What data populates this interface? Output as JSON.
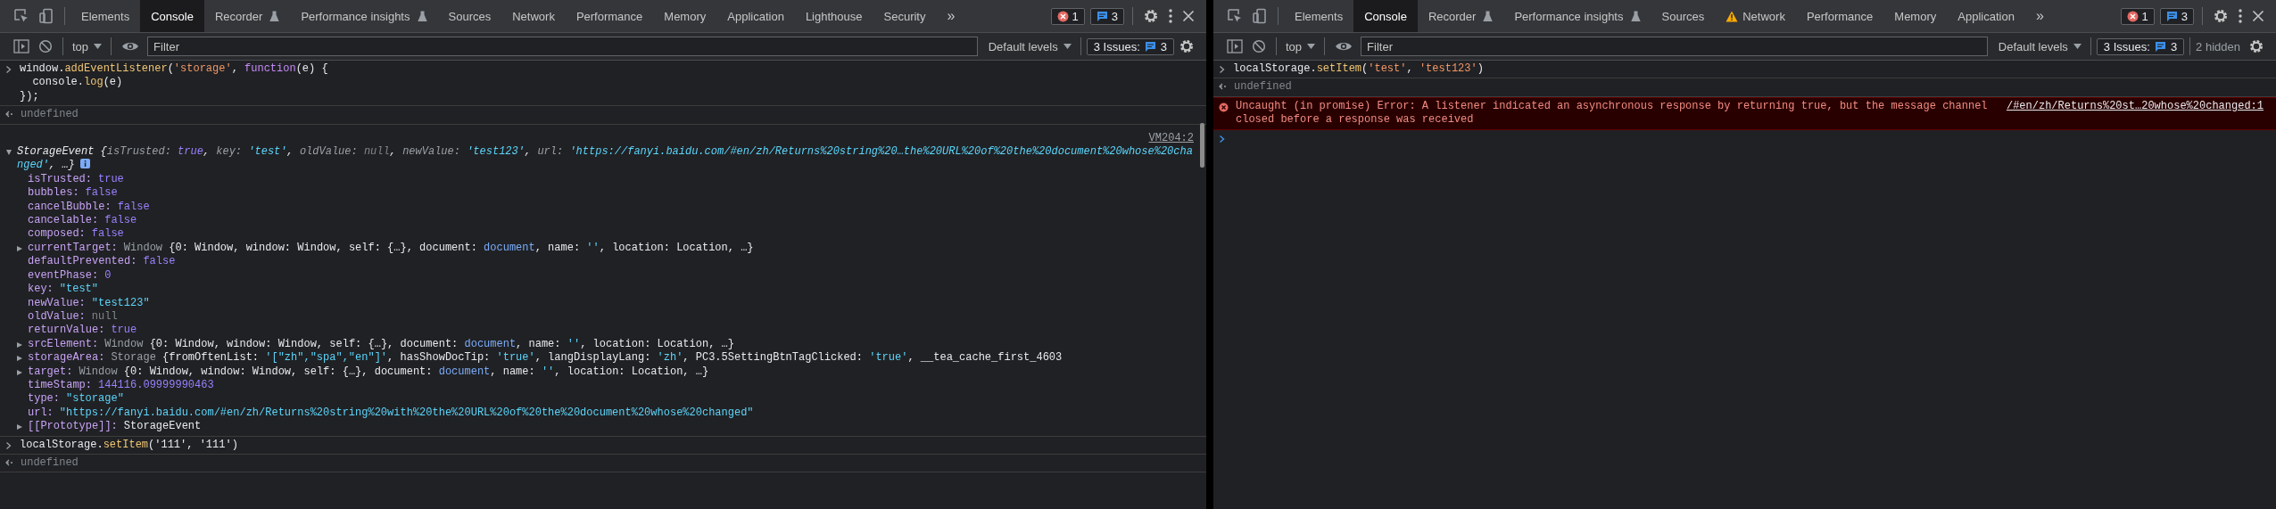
{
  "panels": [
    {
      "tabs": [
        {
          "label": "Elements",
          "selected": false,
          "kind": "standard"
        },
        {
          "label": "Console",
          "selected": true,
          "kind": "standard"
        },
        {
          "label": "Recorder",
          "selected": false,
          "kind": "experimental"
        },
        {
          "label": "Performance insights",
          "selected": false,
          "kind": "experimental"
        },
        {
          "label": "Sources",
          "selected": false,
          "kind": "standard"
        },
        {
          "label": "Network",
          "selected": false,
          "kind": "standard"
        },
        {
          "label": "Performance",
          "selected": false,
          "kind": "standard"
        },
        {
          "label": "Memory",
          "selected": false,
          "kind": "standard"
        },
        {
          "label": "Application",
          "selected": false,
          "kind": "standard"
        },
        {
          "label": "Lighthouse",
          "selected": false,
          "kind": "standard"
        },
        {
          "label": "Security",
          "selected": false,
          "kind": "standard"
        }
      ],
      "overflow": "»",
      "counts": {
        "errors": "1",
        "messages": "3"
      },
      "toolbar": {
        "context": "top",
        "filter": {
          "placeholder": "Filter"
        },
        "levels": "Default levels",
        "issues_label": "3 Issues:",
        "issues_count": "3"
      },
      "console": [
        {
          "kind": "input",
          "lines": [
            [
              {
                "t": "window.",
                "kind": "text"
              },
              {
                "t": "addEventListener",
                "kind": "method"
              },
              {
                "t": "(",
                "kind": "text"
              },
              {
                "t": "'storage'",
                "kind": "literal"
              },
              {
                "t": ", ",
                "kind": "text"
              },
              {
                "t": "function",
                "kind": "keyword"
              },
              {
                "t": "(e) {",
                "kind": "text"
              }
            ],
            [
              {
                "t": "  console.",
                "kind": "text"
              },
              {
                "t": "log",
                "kind": "method"
              },
              {
                "t": "(e)",
                "kind": "text"
              }
            ],
            [
              {
                "t": "});",
                "kind": "text"
              }
            ]
          ]
        },
        {
          "kind": "result",
          "text": "undefined"
        },
        {
          "kind": "object",
          "source": "VM204:2",
          "expanded": true,
          "summary": [
            {
              "t": "StorageEvent {",
              "kind": "text"
            },
            {
              "t": "isTrusted: ",
              "kind": "dim"
            },
            {
              "t": "true",
              "kind": "bool"
            },
            {
              "t": ", ",
              "kind": "text"
            },
            {
              "t": "key: ",
              "kind": "dim"
            },
            {
              "t": "'test'",
              "kind": "string"
            },
            {
              "t": ", ",
              "kind": "text"
            },
            {
              "t": "oldValue: ",
              "kind": "dim"
            },
            {
              "t": "null",
              "kind": "null"
            },
            {
              "t": ", ",
              "kind": "text"
            },
            {
              "t": "newValue: ",
              "kind": "dim"
            },
            {
              "t": "'test123'",
              "kind": "string"
            },
            {
              "t": ", ",
              "kind": "text"
            },
            {
              "t": "url: ",
              "kind": "dim"
            },
            {
              "t": "'https://fanyi.baidu.com/#en/zh/Returns%20string%20…the%20URL%20of%20the%20document%20whose%20changed'",
              "kind": "string"
            },
            {
              "t": ", …}",
              "kind": "text"
            }
          ],
          "props": [
            {
              "name": "isTrusted:",
              "kind": "leaf",
              "value": [
                {
                  "t": "true",
                  "kind": "bool"
                }
              ]
            },
            {
              "name": "bubbles:",
              "kind": "leaf",
              "value": [
                {
                  "t": "false",
                  "kind": "bool"
                }
              ]
            },
            {
              "name": "cancelBubble:",
              "kind": "leaf",
              "value": [
                {
                  "t": "false",
                  "kind": "bool"
                }
              ]
            },
            {
              "name": "cancelable:",
              "kind": "leaf",
              "value": [
                {
                  "t": "false",
                  "kind": "bool"
                }
              ]
            },
            {
              "name": "composed:",
              "kind": "leaf",
              "value": [
                {
                  "t": "false",
                  "kind": "bool"
                }
              ]
            },
            {
              "name": "currentTarget:",
              "kind": "object",
              "expanded": false,
              "value": [
                {
                  "t": "Window ",
                  "kind": "dim"
                },
                {
                  "t": "{0: Window, window: Window, self: {…}, document: ",
                  "kind": "text"
                },
                {
                  "t": "document",
                  "kind": "node"
                },
                {
                  "t": ", name: ",
                  "kind": "text"
                },
                {
                  "t": "''",
                  "kind": "string"
                },
                {
                  "t": ", location: Location, …}",
                  "kind": "text"
                }
              ]
            },
            {
              "name": "defaultPrevented:",
              "kind": "leaf",
              "value": [
                {
                  "t": "false",
                  "kind": "bool"
                }
              ]
            },
            {
              "name": "eventPhase:",
              "kind": "leaf",
              "value": [
                {
                  "t": "0",
                  "kind": "bool"
                }
              ]
            },
            {
              "name": "key:",
              "kind": "leaf",
              "value": [
                {
                  "t": "\"test\"",
                  "kind": "string"
                }
              ]
            },
            {
              "name": "newValue:",
              "kind": "leaf",
              "value": [
                {
                  "t": "\"test123\"",
                  "kind": "string"
                }
              ]
            },
            {
              "name": "oldValue:",
              "kind": "leaf",
              "value": [
                {
                  "t": "null",
                  "kind": "null"
                }
              ]
            },
            {
              "name": "returnValue:",
              "kind": "leaf",
              "value": [
                {
                  "t": "true",
                  "kind": "bool"
                }
              ]
            },
            {
              "name": "srcElement:",
              "kind": "object",
              "expanded": false,
              "value": [
                {
                  "t": "Window ",
                  "kind": "dim"
                },
                {
                  "t": "{0: Window, window: Window, self: {…}, document: ",
                  "kind": "text"
                },
                {
                  "t": "document",
                  "kind": "node"
                },
                {
                  "t": ", name: ",
                  "kind": "text"
                },
                {
                  "t": "''",
                  "kind": "string"
                },
                {
                  "t": ", location: Location, …}",
                  "kind": "text"
                }
              ]
            },
            {
              "name": "storageArea:",
              "kind": "object",
              "expanded": false,
              "value": [
                {
                  "t": "Storage ",
                  "kind": "dim"
                },
                {
                  "t": "{fromOftenList: ",
                  "kind": "text"
                },
                {
                  "t": "'[\"zh\",\"spa\",\"en\"]'",
                  "kind": "string"
                },
                {
                  "t": ", hasShowDocTip: ",
                  "kind": "text"
                },
                {
                  "t": "'true'",
                  "kind": "string"
                },
                {
                  "t": ", langDisplayLang: ",
                  "kind": "text"
                },
                {
                  "t": "'zh'",
                  "kind": "string"
                },
                {
                  "t": ", PC3.5SettingBtnTagClicked: ",
                  "kind": "text"
                },
                {
                  "t": "'true'",
                  "kind": "string"
                },
                {
                  "t": ", __tea_cache_first_4603",
                  "kind": "text"
                }
              ]
            },
            {
              "name": "target:",
              "kind": "object",
              "expanded": false,
              "value": [
                {
                  "t": "Window ",
                  "kind": "dim"
                },
                {
                  "t": "{0: Window, window: Window, self: {…}, document: ",
                  "kind": "text"
                },
                {
                  "t": "document",
                  "kind": "node"
                },
                {
                  "t": ", name: ",
                  "kind": "text"
                },
                {
                  "t": "''",
                  "kind": "string"
                },
                {
                  "t": ", location: Location, …}",
                  "kind": "text"
                }
              ]
            },
            {
              "name": "timeStamp:",
              "kind": "leaf",
              "value": [
                {
                  "t": "144116.09999990463",
                  "kind": "bool"
                }
              ]
            },
            {
              "name": "type:",
              "kind": "leaf",
              "value": [
                {
                  "t": "\"storage\"",
                  "kind": "string"
                }
              ]
            },
            {
              "name": "url:",
              "kind": "leaf",
              "value": [
                {
                  "t": "\"https://fanyi.baidu.com/#en/zh/Returns%20string%20with%20the%20URL%20of%20the%20document%20whose%20changed\"",
                  "kind": "string"
                }
              ]
            },
            {
              "name": "[[Prototype]]:",
              "kind": "object",
              "expanded": false,
              "value": [
                {
                  "t": "StorageEvent",
                  "kind": "text"
                }
              ]
            }
          ]
        },
        {
          "kind": "input",
          "lines": [
            [
              {
                "t": "localStorage.",
                "kind": "text"
              },
              {
                "t": "setItem",
                "kind": "method"
              },
              {
                "t": "('111', '111')",
                "kind": "text"
              }
            ]
          ]
        },
        {
          "kind": "result",
          "text": "undefined"
        }
      ]
    },
    {
      "tabs": [
        {
          "label": "Elements",
          "selected": false,
          "kind": "standard"
        },
        {
          "label": "Console",
          "selected": true,
          "kind": "standard"
        },
        {
          "label": "Recorder",
          "selected": false,
          "kind": "experimental"
        },
        {
          "label": "Performance insights",
          "selected": false,
          "kind": "experimental"
        },
        {
          "label": "Sources",
          "selected": false,
          "kind": "standard"
        },
        {
          "label": "Network",
          "selected": false,
          "kind": "warning"
        },
        {
          "label": "Performance",
          "selected": false,
          "kind": "standard"
        },
        {
          "label": "Memory",
          "selected": false,
          "kind": "standard"
        },
        {
          "label": "Application",
          "selected": false,
          "kind": "standard"
        }
      ],
      "overflow": "»",
      "counts": {
        "errors": "1",
        "messages": "3"
      },
      "toolbar": {
        "context": "top",
        "filter": {
          "placeholder": "Filter"
        },
        "levels": "Default levels",
        "issues_label": "3 Issues:",
        "issues_count": "3",
        "hidden": "2 hidden"
      },
      "console": [
        {
          "kind": "input",
          "lines": [
            [
              {
                "t": "localStorage.",
                "kind": "text"
              },
              {
                "t": "setItem",
                "kind": "method"
              },
              {
                "t": "(",
                "kind": "text"
              },
              {
                "t": "'test'",
                "kind": "literal"
              },
              {
                "t": ", ",
                "kind": "text"
              },
              {
                "t": "'test123'",
                "kind": "literal"
              },
              {
                "t": ")",
                "kind": "text"
              }
            ]
          ]
        },
        {
          "kind": "result",
          "text": "undefined"
        },
        {
          "kind": "error",
          "message": "Uncaught (in promise) Error: A listener indicated an asynchronous response by returning true, but the message channel closed before a response was received",
          "source": "/#en/zh/Returns%20st…20whose%20changed:1"
        },
        {
          "kind": "prompt"
        }
      ]
    }
  ]
}
